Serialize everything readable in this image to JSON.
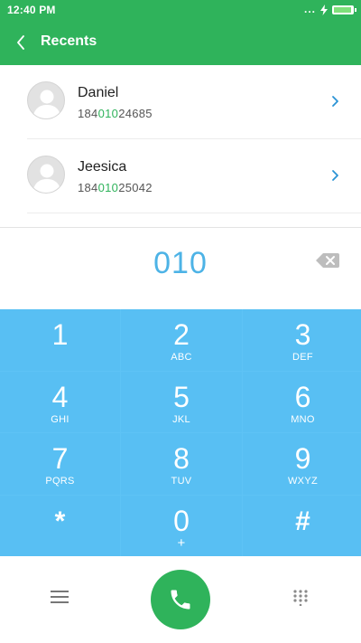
{
  "status_bar": {
    "time": "12:40 PM",
    "signal": "..."
  },
  "header": {
    "title": "Recents"
  },
  "recents": [
    {
      "name": "Daniel",
      "number_prefix": "184",
      "number_match": "010",
      "number_suffix": "24685"
    },
    {
      "name": "Jeesica",
      "number_prefix": "184",
      "number_match": "010",
      "number_suffix": "25042"
    }
  ],
  "dial": {
    "number": "010"
  },
  "keypad": [
    {
      "digit": "1",
      "letters": ""
    },
    {
      "digit": "2",
      "letters": "ABC"
    },
    {
      "digit": "3",
      "letters": "DEF"
    },
    {
      "digit": "4",
      "letters": "GHI"
    },
    {
      "digit": "5",
      "letters": "JKL"
    },
    {
      "digit": "6",
      "letters": "MNO"
    },
    {
      "digit": "7",
      "letters": "PQRS"
    },
    {
      "digit": "8",
      "letters": "TUV"
    },
    {
      "digit": "9",
      "letters": "WXYZ"
    },
    {
      "digit": "*",
      "letters": ""
    },
    {
      "digit": "0",
      "letters": "+"
    },
    {
      "digit": "#",
      "letters": ""
    }
  ],
  "icons": {
    "back": "chevron-left-icon",
    "chevron": "chevron-right-icon",
    "backspace": "backspace-icon",
    "menu": "menu-icon",
    "call": "phone-icon",
    "dialpad": "dialpad-icon"
  },
  "colors": {
    "brand_green": "#2fb35b",
    "keypad_blue": "#58bff3",
    "dial_text": "#4db3e6",
    "chevron": "#2a93d5"
  }
}
